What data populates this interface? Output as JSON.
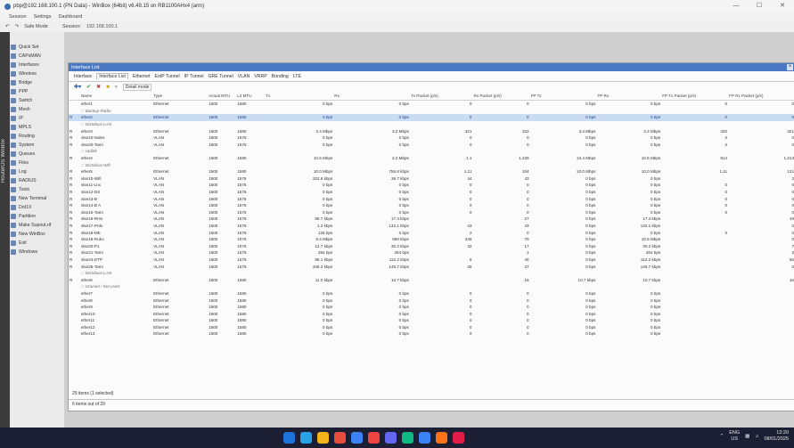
{
  "titlebar": {
    "title": "pbp@192.168.100.1 (PN Data) - WinBox (64bit) v6.49.15 on RB1100AHx4 (arm)"
  },
  "menubar": [
    "Session",
    "Settings",
    "Dashboard"
  ],
  "toolbar": {
    "safe_mode": "Safe Mode",
    "session_label": "Session:",
    "session_value": "192.168.100.1"
  },
  "sidebar": {
    "brand": "RouterOS WinBox",
    "items": [
      "Quick Set",
      "CAPsMAN",
      "Interfaces",
      "Wireless",
      "Bridge",
      "PPP",
      "Switch",
      "Mesh",
      "IP",
      "MPLS",
      "Routing",
      "System",
      "Queues",
      "Files",
      "Log",
      "RADIUS",
      "Tools",
      "New Terminal",
      "Dot1X",
      "Partition",
      "Make Supout.rif",
      "New WinBox",
      "Exit",
      "Windows"
    ]
  },
  "window": {
    "title": "Interface List",
    "tabs": [
      "Interface",
      "Interface List",
      "Ethernet",
      "EoIP Tunnel",
      "IP Tunnel",
      "GRE Tunnel",
      "VLAN",
      "VRRP",
      "Bonding",
      "LTE"
    ],
    "detail_mode": "Detail mode",
    "columns": [
      "",
      "Name",
      "Type",
      "Actual MTU",
      "L2 MTU",
      "Tx",
      "Rx",
      "Tx Packet (p/s)",
      "Rx Packet (p/s)",
      "FP Tx",
      "FP Rx",
      "FP Tx Packet (p/s)",
      "FP Rx Packet (p/s)"
    ],
    "rows": [
      {
        "f": "",
        "name": "ether1",
        "type": "Ethernet",
        "mtu": "1500",
        "l2": "1580",
        "tx": "0 bps",
        "rx": "0 bps",
        "txp": "0",
        "rxp": "0",
        "fptx": "0 bps",
        "fprx": "0 bps",
        "fptxp": "0",
        "fprxp": "0",
        "kind": "row"
      },
      {
        "f": "",
        "name": "::: Backup Radio",
        "kind": "grp"
      },
      {
        "f": "R",
        "name": "ether2",
        "type": "Ethernet",
        "mtu": "1500",
        "l2": "1580",
        "tx": "0 bps",
        "rx": "0 bps",
        "txp": "0",
        "rxp": "0",
        "fptx": "0 bps",
        "fprx": "0 bps",
        "fptxp": "0",
        "fprxp": "0",
        "kind": "sel"
      },
      {
        "f": "",
        "name": "::: Distribusi LAN",
        "kind": "grp"
      },
      {
        "f": "R",
        "name": "ether3",
        "type": "Ethernet",
        "mtu": "1500",
        "l2": "1580",
        "tx": "3.4 Mbps",
        "rx": "3.2 Mbps",
        "txp": "321",
        "rxp": "322",
        "fptx": "3.4 Mbps",
        "fprx": "3.2 Mbps",
        "fptxp": "320",
        "fprxp": "321",
        "kind": "row"
      },
      {
        "f": "R",
        "name": "vlan10-Sales",
        "type": "VLAN",
        "mtu": "1500",
        "l2": "1576",
        "tx": "0 bps",
        "rx": "0 bps",
        "txp": "0",
        "rxp": "0",
        "fptx": "0 bps",
        "fprx": "0 bps",
        "fptxp": "0",
        "fprxp": "0",
        "kind": "row"
      },
      {
        "f": "R",
        "name": "vlan20-Tami",
        "type": "VLAN",
        "mtu": "1500",
        "l2": "1576",
        "tx": "0 bps",
        "rx": "0 bps",
        "txp": "0",
        "rxp": "0",
        "fptx": "0 bps",
        "fprx": "0 bps",
        "fptxp": "0",
        "fprxp": "0",
        "kind": "row"
      },
      {
        "f": "",
        "name": "::: Uplink",
        "kind": "grp"
      },
      {
        "f": "R",
        "name": "ether4",
        "type": "Ethernet",
        "mtu": "1500",
        "l2": "1580",
        "tx": "10.5 Mbps",
        "rx": "2.2 Mbps",
        "txp": "1.1",
        "rxp": "1,229",
        "fptx": "10.4 Mbps",
        "fprx": "10.5 Mbps",
        "fptxp": "914",
        "fprxp": "1,213",
        "kind": "row"
      },
      {
        "f": "",
        "name": "::: Distribusi Wifi",
        "kind": "grp"
      },
      {
        "f": "R",
        "name": "ether5",
        "type": "Ethernet",
        "mtu": "1500",
        "l2": "1580",
        "tx": "10.0 Mbps",
        "rx": "755.6 kbps",
        "txp": "1,11",
        "rxp": "104",
        "fptx": "10.0 Mbps",
        "fprx": "10.0 Mbps",
        "fptxp": "1,11",
        "fprxp": "121",
        "kind": "row"
      },
      {
        "f": "R",
        "name": "vlan10-Wifi",
        "type": "VLAN",
        "mtu": "1500",
        "l2": "1576",
        "tx": "322.6 kbps",
        "rx": "36.7 kbps",
        "txp": "44",
        "rxp": "43",
        "fptx": "0 bps",
        "fprx": "0 bps",
        "fptxp": "",
        "fprxp": "2",
        "kind": "row"
      },
      {
        "f": "R",
        "name": "vlan11-Lnx",
        "type": "VLAN",
        "mtu": "1500",
        "l2": "1576",
        "tx": "0 bps",
        "rx": "0 bps",
        "txp": "0",
        "rxp": "0",
        "fptx": "0 bps",
        "fprx": "0 bps",
        "fptxp": "0",
        "fprxp": "0",
        "kind": "row"
      },
      {
        "f": "R",
        "name": "vlan12-DS",
        "type": "VLAN",
        "mtu": "1500",
        "l2": "1576",
        "tx": "0 bps",
        "rx": "0 bps",
        "txp": "0",
        "rxp": "0",
        "fptx": "0 bps",
        "fprx": "0 bps",
        "fptxp": "0",
        "fprxp": "0",
        "kind": "row"
      },
      {
        "f": "R",
        "name": "vlan13-B",
        "type": "VLAN",
        "mtu": "1500",
        "l2": "1576",
        "tx": "0 bps",
        "rx": "0 bps",
        "txp": "0",
        "rxp": "0",
        "fptx": "0 bps",
        "fprx": "0 bps",
        "fptxp": "0",
        "fprxp": "0",
        "kind": "row"
      },
      {
        "f": "R",
        "name": "vlan14-B A",
        "type": "VLAN",
        "mtu": "1500",
        "l2": "1576",
        "tx": "0 bps",
        "rx": "0 bps",
        "txp": "0",
        "rxp": "0",
        "fptx": "0 bps",
        "fprx": "0 bps",
        "fptxp": "0",
        "fprxp": "0",
        "kind": "row"
      },
      {
        "f": "R",
        "name": "vlan15-Tami",
        "type": "VLAN",
        "mtu": "1500",
        "l2": "1576",
        "tx": "0 bps",
        "rx": "0 bps",
        "txp": "0",
        "rxp": "0",
        "fptx": "0 bps",
        "fprx": "0 bps",
        "fptxp": "0",
        "fprxp": "0",
        "kind": "row"
      },
      {
        "f": "R",
        "name": "vlan16-Rms",
        "type": "VLAN",
        "mtu": "1500",
        "l2": "1576",
        "tx": "86.7 kbps",
        "rx": "17.4 kbps",
        "txp": "",
        "rxp": "27",
        "fptx": "0 bps",
        "fprx": "17.4 kbps",
        "fptxp": "",
        "fprxp": "19",
        "kind": "row"
      },
      {
        "f": "R",
        "name": "vlan17-Prdx",
        "type": "VLAN",
        "mtu": "1500",
        "l2": "1576",
        "tx": "1.2 kbps",
        "rx": "132.1 kbps",
        "txp": "43",
        "rxp": "43",
        "fptx": "0 bps",
        "fprx": "132.1 kbps",
        "fptxp": "",
        "fprxp": "0",
        "kind": "row"
      },
      {
        "f": "R",
        "name": "vlan18-ME",
        "type": "VLAN",
        "mtu": "1500",
        "l2": "1576",
        "tx": "128 bps",
        "rx": "0 bps",
        "txp": "2",
        "rxp": "0",
        "fptx": "0 bps",
        "fprx": "0 bps",
        "fptxp": "0",
        "fprxp": "0",
        "kind": "row"
      },
      {
        "f": "R",
        "name": "vlan19-Ruko",
        "type": "VLAN",
        "mtu": "1500",
        "l2": "1576",
        "tx": "9.4 Mbps",
        "rx": "560 kbps",
        "txp": "346",
        "rxp": "76",
        "fptx": "0 bps",
        "fprx": "10.5 Mbps",
        "fptxp": "",
        "fprxp": "0",
        "kind": "row"
      },
      {
        "f": "R",
        "name": "vlan20-P1",
        "type": "VLAN",
        "mtu": "1500",
        "l2": "1576",
        "tx": "12.7 kbps",
        "rx": "30.2 kbps",
        "txp": "32",
        "rxp": "17",
        "fptx": "0 bps",
        "fprx": "30.2 kbps",
        "fptxp": "",
        "fprxp": "7",
        "kind": "row"
      },
      {
        "f": "R",
        "name": "vlan21-Tami",
        "type": "VLAN",
        "mtu": "1500",
        "l2": "1576",
        "tx": "264 bps",
        "rx": "264 bps",
        "txp": "",
        "rxp": "1",
        "fptx": "0 bps",
        "fprx": "264 bps",
        "fptxp": "",
        "fprxp": "2",
        "kind": "row"
      },
      {
        "f": "R",
        "name": "vlan24-DTP",
        "type": "VLAN",
        "mtu": "1500",
        "l2": "1576",
        "tx": "95.1 kbps",
        "rx": "112.2 kbps",
        "txp": "6",
        "rxp": "40",
        "fptx": "0 bps",
        "fprx": "112.2 kbps",
        "fptxp": "",
        "fprxp": "65",
        "kind": "row"
      },
      {
        "f": "R",
        "name": "vlan25-Tami",
        "type": "VLAN",
        "mtu": "1500",
        "l2": "1576",
        "tx": "346.2 kbps",
        "rx": "145.7 kbps",
        "txp": "25",
        "rxp": "37",
        "fptx": "0 bps",
        "fprx": "145.7 kbps",
        "fptxp": "",
        "fprxp": "0",
        "kind": "row"
      },
      {
        "f": "",
        "name": "::: Distribusi LAN",
        "kind": "grp"
      },
      {
        "f": "R",
        "name": "ether6",
        "type": "Ethernet",
        "mtu": "1500",
        "l2": "1580",
        "tx": "11.0 kbps",
        "rx": "10.7 kbps",
        "txp": "",
        "rxp": "16",
        "fptx": "10.7 kbps",
        "fprx": "10.7 kbps",
        "fptxp": "",
        "fprxp": "16",
        "kind": "row"
      },
      {
        "f": "",
        "name": "::: Unused / Not used",
        "kind": "grp"
      },
      {
        "f": "",
        "name": "ether7",
        "type": "Ethernet",
        "mtu": "1500",
        "l2": "1580",
        "tx": "0 bps",
        "rx": "0 bps",
        "txp": "0",
        "rxp": "0",
        "fptx": "0 bps",
        "fprx": "0 bps",
        "fptxp": "",
        "fprxp": "",
        "kind": "row"
      },
      {
        "f": "",
        "name": "ether8",
        "type": "Ethernet",
        "mtu": "1500",
        "l2": "1580",
        "tx": "0 bps",
        "rx": "0 bps",
        "txp": "0",
        "rxp": "0",
        "fptx": "0 bps",
        "fprx": "0 bps",
        "fptxp": "",
        "fprxp": "",
        "kind": "row"
      },
      {
        "f": "",
        "name": "ether9",
        "type": "Ethernet",
        "mtu": "1500",
        "l2": "1580",
        "tx": "0 bps",
        "rx": "0 bps",
        "txp": "0",
        "rxp": "0",
        "fptx": "0 bps",
        "fprx": "0 bps",
        "fptxp": "",
        "fprxp": "",
        "kind": "row"
      },
      {
        "f": "",
        "name": "ether10",
        "type": "Ethernet",
        "mtu": "1500",
        "l2": "1580",
        "tx": "0 bps",
        "rx": "0 bps",
        "txp": "0",
        "rxp": "0",
        "fptx": "0 bps",
        "fprx": "0 bps",
        "fptxp": "",
        "fprxp": "",
        "kind": "row"
      },
      {
        "f": "",
        "name": "ether11",
        "type": "Ethernet",
        "mtu": "1500",
        "l2": "1580",
        "tx": "0 bps",
        "rx": "0 bps",
        "txp": "0",
        "rxp": "0",
        "fptx": "0 bps",
        "fprx": "0 bps",
        "fptxp": "",
        "fprxp": "",
        "kind": "row"
      },
      {
        "f": "",
        "name": "ether12",
        "type": "Ethernet",
        "mtu": "1500",
        "l2": "1580",
        "tx": "0 bps",
        "rx": "0 bps",
        "txp": "0",
        "rxp": "0",
        "fptx": "0 bps",
        "fprx": "0 bps",
        "fptxp": "",
        "fprxp": "",
        "kind": "row"
      },
      {
        "f": "",
        "name": "ether13",
        "type": "Ethernet",
        "mtu": "1500",
        "l2": "1580",
        "tx": "0 bps",
        "rx": "0 bps",
        "txp": "0",
        "rxp": "0",
        "fptx": "0 bps",
        "fprx": "0 bps",
        "fptxp": "",
        "fprxp": "",
        "kind": "row"
      }
    ],
    "status_items": "29 items (1 selected)",
    "status_filter": "6 items out of 29"
  },
  "taskbar": {
    "icon_colors": [
      "#1e73d8",
      "#2aa0e8",
      "#f3b41b",
      "#e74c3c",
      "#3b82f6",
      "#ef4444",
      "#6366f1",
      "#10b981",
      "#3b82f6",
      "#f97316",
      "#e11d48"
    ],
    "lang": "ENG",
    "region": "US",
    "time": "13:20",
    "date": "08/01/2025"
  },
  "colors": {
    "accent": "#4a78c2",
    "selected_row": "#c9dcf2",
    "taskbar": "#1c1f33"
  }
}
